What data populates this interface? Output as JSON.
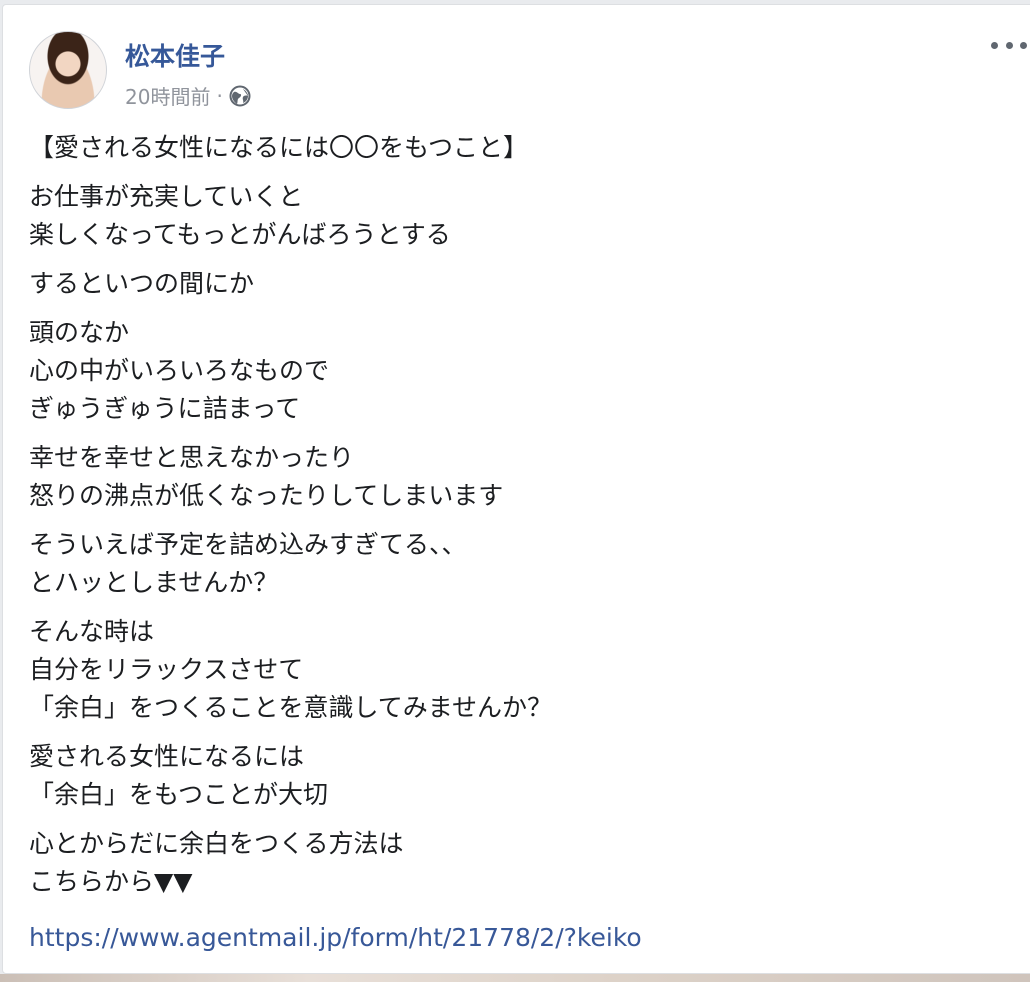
{
  "post": {
    "author": "松本佳子",
    "time": "20時間前",
    "separator": "·",
    "privacy_icon": "globe-icon",
    "more_icon": "more-horizontal-icon",
    "paragraphs": [
      {
        "lines": [
          "【愛される女性になるには〇〇をもつこと】"
        ]
      },
      {
        "lines": [
          "お仕事が充実していくと",
          "楽しくなってもっとがんばろうとする"
        ]
      },
      {
        "lines": [
          "するといつの間にか"
        ]
      },
      {
        "lines": [
          "頭のなか",
          "心の中がいろいろなもので",
          "ぎゅうぎゅうに詰まって"
        ]
      },
      {
        "lines": [
          "幸せを幸せと思えなかったり",
          "怒りの沸点が低くなったりしてしまいます"
        ]
      },
      {
        "lines": [
          "そういえば予定を詰め込みすぎてる、、",
          "とハッとしませんか？"
        ]
      },
      {
        "lines": [
          "そんな時は",
          "自分をリラックスさせて",
          "「余白」をつくることを意識してみませんか？"
        ]
      },
      {
        "lines": [
          "愛される女性になるには",
          "「余白」をもつことが大切"
        ]
      },
      {
        "lines": [
          "心とからだに余白をつくる方法は",
          "こちらから▼▼"
        ]
      }
    ],
    "link": "https://www.agentmail.jp/form/ht/21778/2/?keiko"
  },
  "colors": {
    "author": "#365899",
    "meta": "#90949c",
    "text": "#1c1e21",
    "link": "#385898"
  }
}
